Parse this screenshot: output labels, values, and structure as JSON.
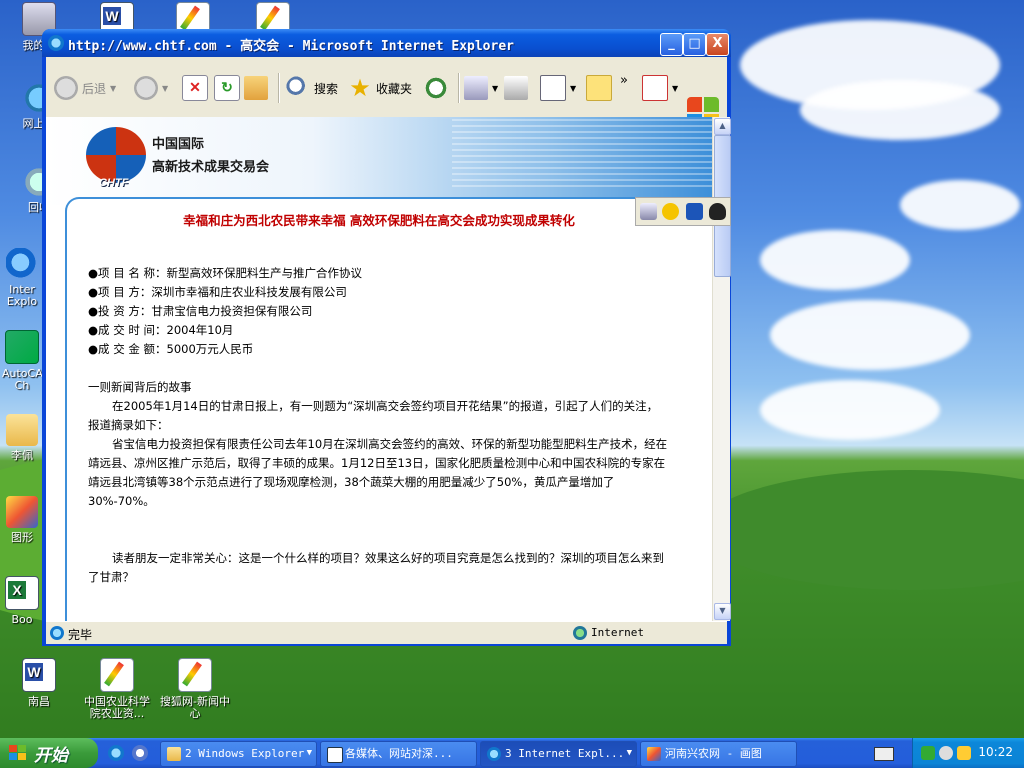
{
  "desktop": {
    "icons": [
      {
        "label": "我的电",
        "icon": "my-computer-icon"
      },
      {
        "label": "网上邻",
        "icon": "network-icon"
      },
      {
        "label": "回收",
        "icon": "recycle-bin-icon"
      },
      {
        "label": "Inter Explo",
        "icon": "internet-explorer-icon"
      },
      {
        "label": "AutoCAD Ch",
        "icon": "autocad-icon"
      },
      {
        "label": "李佩",
        "icon": "folder-icon"
      },
      {
        "label": "图形",
        "icon": "paint-icon"
      },
      {
        "label": "Boo",
        "icon": "excel-icon"
      },
      {
        "label": "南昌",
        "icon": "word-doc-icon"
      },
      {
        "label": "中国农业科学院农业资...",
        "icon": "web-page-icon"
      },
      {
        "label": "搜狐网-新闻中心",
        "icon": "web-page-icon"
      }
    ]
  },
  "window": {
    "title": "http://www.chtf.com - 高交会 - Microsoft Internet Explorer",
    "controls": {
      "minimize": "_",
      "maximize": "□",
      "close": "X"
    },
    "toolbar": {
      "back": "后退",
      "search": "搜索",
      "favorites": "收藏夹",
      "more": "»"
    },
    "status": {
      "text": "完毕",
      "zone": "Internet"
    }
  },
  "page": {
    "banner": {
      "line1": "中国国际",
      "line2": "高新技术成果交易会",
      "logo_text": "CHTF"
    },
    "headline": "幸福和庄为西北农民带来幸福  高效环保肥料在高交会成功实现成果转化",
    "facts": [
      "●项 目 名 称：新型高效环保肥料生产与推广合作协议",
      "●项    目    方：深圳市幸福和庄农业科技发展有限公司",
      "●投    资    方：甘肃宝信电力投资担保有限公司",
      "●成 交 时 间：2004年10月",
      "●成 交 金 额：5000万元人民币"
    ],
    "story_title": "一则新闻背后的故事",
    "p1": "在2005年1月14日的甘肃日报上，有一则题为“深圳高交会签约项目开花结果”的报道，引起了人们的关注，报道摘录如下：",
    "p2": "省宝信电力投资担保有限责任公司去年10月在深圳高交会签约的高效、环保的新型功能型肥料生产技术，经在靖远县、凉州区推广示范后，取得了丰硕的成果。1月12日至13日，国家化肥质量检测中心和中国农科院的专家在靖远县北湾镇等38个示范点进行了现场观摩检测，38个蔬菜大棚的用肥量减少了50%，黄瓜产量增加了30%-70%。",
    "p3": "读者朋友一定非常关心：这是一个什么样的项目？效果这么好的项目究竟是怎么找到的？深圳的项目怎么来到了甘肃？"
  },
  "taskbar": {
    "start": "开始",
    "tasks": [
      {
        "label": "2 Windows Explorer",
        "active": false
      },
      {
        "label": "各媒体、网站对深...",
        "active": false
      },
      {
        "label": "3 Internet Expl...",
        "active": true
      },
      {
        "label": "河南兴农网 - 画图",
        "active": false
      }
    ],
    "clock": "10:22"
  }
}
